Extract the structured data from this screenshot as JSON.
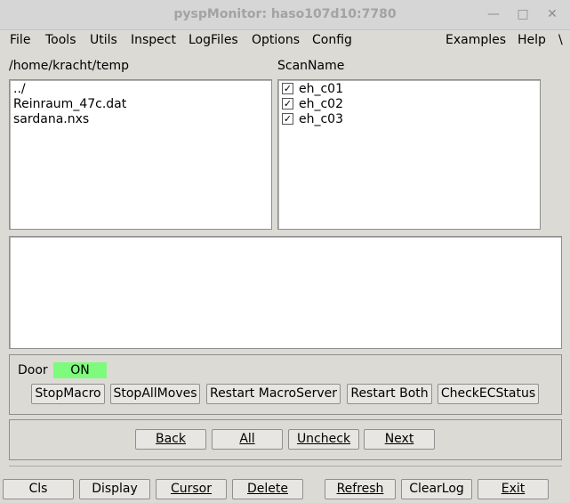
{
  "window": {
    "title": "pyspMonitor: haso107d10:7780"
  },
  "menus": {
    "file": "File",
    "tools": "Tools",
    "utils": "Utils",
    "inspect": "Inspect",
    "logfiles": "LogFiles",
    "options": "Options",
    "config": "Config",
    "examples": "Examples",
    "help": "Help",
    "more": "\\"
  },
  "files": {
    "path": "/home/kracht/temp",
    "entries": [
      "../",
      "Reinraum_47c.dat",
      "sardana.nxs"
    ]
  },
  "scans": {
    "header": "ScanName",
    "items": [
      {
        "name": "eh_c01",
        "checked": true
      },
      {
        "name": "eh_c02",
        "checked": true
      },
      {
        "name": "eh_c03",
        "checked": true
      }
    ]
  },
  "log": {
    "text": ""
  },
  "door": {
    "label": "Door",
    "state": "ON",
    "state_color": "#7dfb7d"
  },
  "macro_buttons": {
    "stop_macro": "StopMacro",
    "stop_all_moves": "StopAllMoves",
    "restart_macroserver": "Restart MacroServer",
    "restart_both": "Restart Both",
    "check_ec_status": "CheckECStatus"
  },
  "nav_buttons": {
    "back": "Back",
    "all": "All",
    "uncheck": "Uncheck",
    "next": "Next"
  },
  "bottom_buttons": {
    "cls": "Cls",
    "display": "Display",
    "cursor": "Cursor",
    "delete": "Delete",
    "refresh": "Refresh",
    "clearlog": "ClearLog",
    "exit": "Exit"
  },
  "checkmark": "✓"
}
